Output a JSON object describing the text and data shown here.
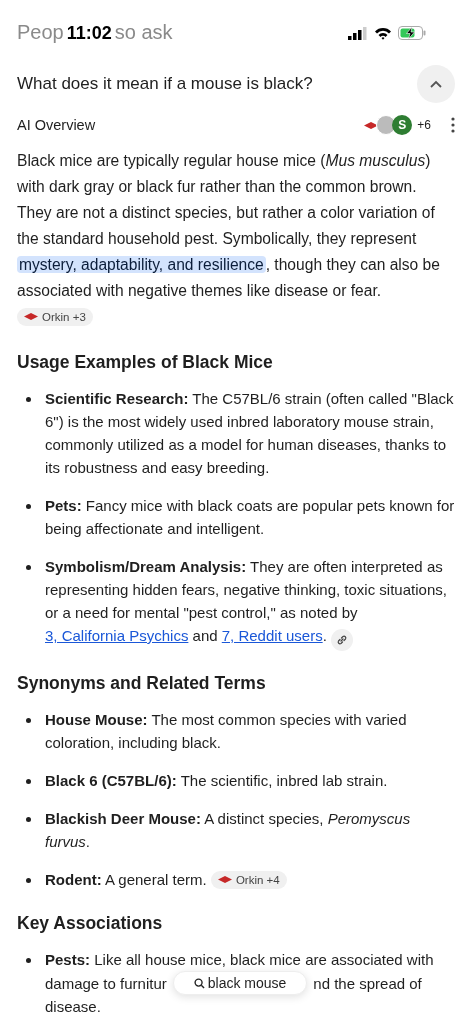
{
  "status_bar": {
    "time": "11:02",
    "charging": true
  },
  "section_title_parts": [
    "Peop",
    "so ask"
  ],
  "question": {
    "text": "What does it mean if a mouse is black?",
    "expanded": true
  },
  "overview": {
    "label": "AI Overview",
    "source_letter": "S",
    "source_count": "+6"
  },
  "intro": {
    "text_before": "Black mice are typically regular house mice (*Mus musculus*) with dark gray or black fur rather than the common brown. They are not a distinct species, but rather a color variation of the standard household pest. Symbolically, they represent ",
    "highlighted_text": "mystery, adaptability, and resilience",
    "text_after": ", though they can also be associated with negative themes like disease or fear.",
    "chip": "Orkin +3"
  },
  "sections": [
    {
      "heading": "Usage Examples of Black Mice",
      "items": [
        {
          "term": "Scientific Research:",
          "segments": [
            {
              "kind": "text",
              "text": "The C57BL/6 strain (often called \"Black 6\") is the most widely used inbred laboratory mouse strain, commonly utilized as a model for human diseases, thanks to its robustness and easy breeding."
            }
          ]
        },
        {
          "term": "Pets:",
          "segments": [
            {
              "kind": "text",
              "text": "Fancy mice with black coats are popular pets known for being affectionate and intelligent."
            }
          ]
        },
        {
          "term": "Symbolism/Dream Analysis:",
          "segments": [
            {
              "kind": "text",
              "text": "They are often interpreted as representing hidden fears, negative thinking, toxic situations, or a need for mental \"pest control,\" as noted by "
            },
            {
              "kind": "link",
              "text": "3, California Psychics"
            },
            {
              "kind": "text",
              "text": " and "
            },
            {
              "kind": "link",
              "text": "7, Reddit users"
            },
            {
              "kind": "text",
              "text": "."
            },
            {
              "kind": "link_chip"
            }
          ]
        }
      ]
    },
    {
      "heading": "Synonyms and Related Terms",
      "items": [
        {
          "term": "House Mouse:",
          "segments": [
            {
              "kind": "text",
              "text": "The most common species with varied coloration, including black."
            }
          ]
        },
        {
          "term": "Black 6 (C57BL/6):",
          "segments": [
            {
              "kind": "text",
              "text": "The scientific, inbred lab strain."
            }
          ]
        },
        {
          "term": "Blackish Deer Mouse:",
          "segments": [
            {
              "kind": "text",
              "text": "A distinct species, *Peromyscus furvus*."
            }
          ]
        },
        {
          "term": "Rodent:",
          "segments": [
            {
              "kind": "text",
              "text": "A general term."
            },
            {
              "kind": "source_chip",
              "text": "Orkin +4"
            }
          ]
        }
      ]
    },
    {
      "heading": "Key Associations",
      "items": [
        {
          "term": "Pests:",
          "segments": [
            {
              "kind": "text",
              "text": "Like all house mice, black mice are associated with damage to furnitur"
            },
            {
              "kind": "search",
              "text": "black mouse"
            },
            {
              "kind": "text",
              "text": "nd the spread of disease."
            }
          ]
        }
      ]
    }
  ]
}
